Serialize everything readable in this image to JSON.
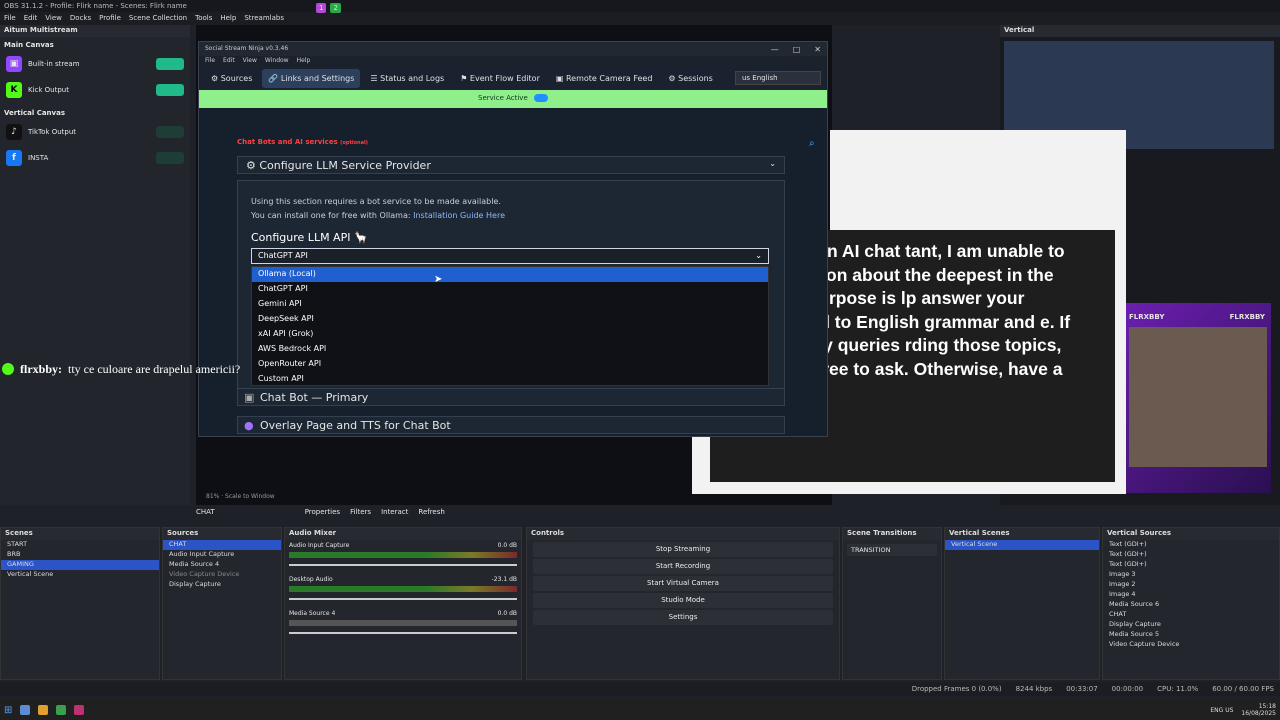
{
  "obs": {
    "title": "OBS 31.1.2 - Profile: Flirk name - Scenes: Flirk name",
    "menu": [
      "File",
      "Edit",
      "View",
      "Docks",
      "Profile",
      "Scene Collection",
      "Tools",
      "Help",
      "Streamlabs"
    ],
    "top_badges": [
      "1",
      "2"
    ]
  },
  "aitum": {
    "title": "Aitum Multistream",
    "main_canvas": "Main Canvas",
    "outputs_main": [
      {
        "label": "Built-in stream",
        "icon": "twitch-icon",
        "color": "#9146ff"
      },
      {
        "label": "Kick Output",
        "icon": "kick-icon",
        "color": "#53fc18"
      }
    ],
    "vertical_canvas": "Vertical Canvas",
    "outputs_vertical": [
      {
        "label": "TikTok Output",
        "icon": "tiktok-icon",
        "color": "#111111"
      },
      {
        "label": "INSTA",
        "icon": "facebook-icon",
        "color": "#1877f2"
      }
    ]
  },
  "vertical": {
    "title": "Vertical"
  },
  "ssn": {
    "title": "Social Stream Ninja v0.3.46",
    "menu": [
      "File",
      "Edit",
      "View",
      "Window",
      "Help"
    ],
    "tabs": [
      "Sources",
      "Links and Settings",
      "Status and Logs",
      "Event Flow Editor",
      "Remote Camera Feed",
      "Sessions"
    ],
    "lang": "us English",
    "service": "Service Active",
    "chatbots_label": "Chat Bots and AI services",
    "chatbots_tag": "(optional)",
    "llm_header": "⚙ Configure LLM Service Provider",
    "info1": "Using this section requires a bot service to be made available.",
    "info2_prefix": "You can install one for free with Ollama:",
    "info2_link": "Installation Guide Here",
    "config_api": "Configure LLM API 🦙",
    "selected": "ChatGPT API",
    "options": [
      "Ollama (Local)",
      "ChatGPT API",
      "Gemini API",
      "DeepSeek API",
      "xAI API (Grok)",
      "AWS Bedrock API",
      "OpenRouter API",
      "Custom API"
    ],
    "highlighted_index": 0,
    "chatbot_primary": "Chat Bot — Primary",
    "overlay": "Overlay Page and TTS for Chat Bot"
  },
  "chat_overlay": {
    "user": "flrxbby:",
    "message": "tty ce culoare are drapelul americii?"
  },
  "caption": "orry but as an AI chat tant, I am unable to provide mation about the deepest in the world. My purpose is lp answer your questions ed to English grammar and e. If you have any queries rding those topics, please feel free to ask. Otherwise, have a great day!",
  "cam_labels": [
    "FLRXBBY",
    "FLRXBBY"
  ],
  "preview_bar": {
    "source": "CHAT",
    "buttons": [
      "Properties",
      "Filters",
      "Interact",
      "Refresh"
    ],
    "scale": "81% · Scale to Window"
  },
  "docks": {
    "scenes_title": "Scenes",
    "scenes": [
      "START",
      "BRB",
      "GAMING",
      "Vertical Scene"
    ],
    "active_scene": "GAMING",
    "sources_title": "Sources",
    "sources": [
      "CHAT",
      "Audio Input Capture",
      "Media Source 4",
      "Video Capture Device",
      "Display Capture"
    ],
    "mixer_title": "Audio Mixer",
    "mixer": [
      {
        "name": "Audio Input Capture",
        "db": "0.0 dB"
      },
      {
        "name": "Desktop Audio",
        "db": "-23.1 dB"
      },
      {
        "name": "Media Source 4",
        "db": "0.0 dB"
      }
    ],
    "controls_title": "Controls",
    "controls": [
      "Stop Streaming",
      "Start Recording",
      "Start Virtual Camera",
      "Studio Mode",
      "Settings"
    ],
    "transitions_title": "Scene Transitions",
    "transition": "TRANSITION",
    "vscenes_title": "Vertical Scenes",
    "vscenes": [
      "Vertical Scene"
    ],
    "vsources_title": "Vertical Sources",
    "vsources": [
      "Text (GDI+)",
      "Text (GDI+)",
      "Text (GDI+)",
      "Image 3",
      "Image 2",
      "Image 4",
      "Media Source 6",
      "CHAT",
      "Display Capture",
      "Media Source 5",
      "Video Capture Device"
    ]
  },
  "status": [
    "Dropped Frames 0 (0.0%)",
    "8244 kbps",
    "00:33:07",
    "00:00:00",
    "CPU: 11.0%",
    "60.00 / 60.00 FPS"
  ],
  "tray": {
    "lang": "ENG US",
    "time": "15:18",
    "date": "16/08/2025"
  }
}
